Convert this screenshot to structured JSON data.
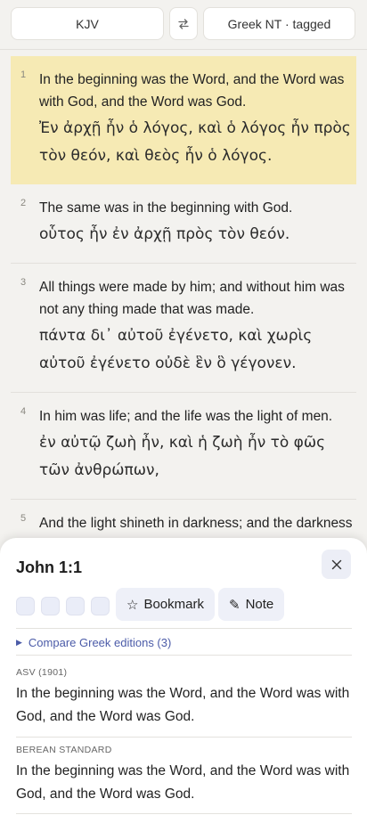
{
  "header": {
    "left_translation": "KJV",
    "swap_icon": "swap-arrows-icon",
    "right_translation": "Greek NT · tagged"
  },
  "verses": [
    {
      "num": "1",
      "en": "In the beginning was the Word, and the Word was with God, and the Word was God.",
      "gr": "Ἐν ἀρχῇ ἦν ὁ λόγος, καὶ ὁ λόγος ἦν πρὸς τὸν θεόν, καὶ θεὸς ἦν ὁ λόγος."
    },
    {
      "num": "2",
      "en": "The same was in the beginning with God.",
      "gr": "οὗτος ἦν ἐν ἀρχῇ πρὸς τὸν θεόν."
    },
    {
      "num": "3",
      "en": "All things were made by him; and without him was not any thing made that was made.",
      "gr": "πάντα δι᾽ αὐτοῦ ἐγένετο, καὶ χωρὶς αὐτοῦ ἐγένετο οὐδὲ ἓν ὃ γέγονεν."
    },
    {
      "num": "4",
      "en": "In him was life; and the life was the light of men.",
      "gr": "ἐν αὐτῷ ζωὴ ἦν, καὶ ἡ ζωὴ ἦν τὸ φῶς τῶν ἀνθρώπων,"
    },
    {
      "num": "5",
      "en": "And the light shineth in darkness; and the darkness comprehended it not.",
      "gr": ""
    }
  ],
  "sheet": {
    "reference": "John 1:1",
    "close_icon": "close-icon",
    "highlight_colors": [
      "#eaedf8",
      "#eaedf8",
      "#eaedf8",
      "#eaedf8"
    ],
    "bookmark_icon": "☆",
    "bookmark_label": "Bookmark",
    "note_icon": "✎",
    "note_label": "Note",
    "compare_caret": "▶",
    "compare_label": "Compare Greek editions (3)",
    "editions": [
      {
        "name": "ASV (1901)",
        "text": "In the beginning was the Word, and the Word was with God, and the Word was God."
      },
      {
        "name": "BEREAN STANDARD",
        "text": "In the beginning was the Word, and the Word was with God, and the Word was God."
      }
    ]
  },
  "colors": {
    "accent": "#4b5ba8",
    "active_verse": "#f6eab4",
    "background": "#f3f2ef"
  }
}
